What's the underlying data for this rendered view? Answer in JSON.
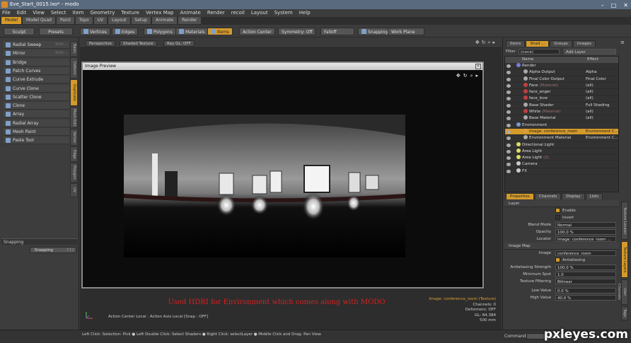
{
  "window": {
    "title": "Eve_Start_0015.lxo* - modo",
    "buttons": [
      "–",
      "□",
      "✕"
    ]
  },
  "menu": [
    "File",
    "Edit",
    "View",
    "Select",
    "Item",
    "Geometry",
    "Texture",
    "Vertex Map",
    "Animate",
    "Render",
    "recoil",
    "Layout",
    "System",
    "Help"
  ],
  "mode_tabs": [
    {
      "label": "Model",
      "active": true
    },
    {
      "label": "Model Quad"
    },
    {
      "label": "Paint"
    },
    {
      "label": "Topo"
    },
    {
      "label": "UV"
    },
    {
      "label": "Layout"
    },
    {
      "label": "Setup"
    },
    {
      "label": "Animate"
    },
    {
      "label": "Render"
    }
  ],
  "toolbar": {
    "sculpt": "Sculpt",
    "presets": "Presets",
    "vertices": "Vertices",
    "edges": "Edges",
    "polygons": "Polygons",
    "materials": "Materials",
    "items": "Items",
    "action_center": "Action Center",
    "symmetry": "Symmetry: Off",
    "falloff": "Falloff",
    "snapping": "Snapping",
    "work_plane": "Work Plane"
  },
  "left_tools": [
    {
      "label": "Radial Sweep",
      "shortcut": "Shift-..."
    },
    {
      "label": "Mirror",
      "shortcut": "Shift-..."
    },
    {
      "label": "Bridge"
    },
    {
      "label": "Patch Curves"
    },
    {
      "label": "Curve Extrude"
    },
    {
      "label": "Curve Clone"
    },
    {
      "label": "Scatter Clone"
    },
    {
      "label": "Clone"
    },
    {
      "label": "Array"
    },
    {
      "label": "Radial Array"
    },
    {
      "label": "Mesh Paint"
    },
    {
      "label": "Paste Tool"
    }
  ],
  "left_vtabs": [
    "Basic",
    "Deform",
    "Duplicate",
    "Mesh Edit",
    "Vertex",
    "Edge",
    "Polygon",
    "UV"
  ],
  "snapping": {
    "header": "Snapping",
    "button": "Snapping",
    "shortcut": "F11"
  },
  "viewport": {
    "perspective": "Perspective",
    "shade": "Shaded Texture",
    "raygl": "Ray GL: OFF",
    "preview_title": "Image Preview",
    "caption": "Used HDRI for Environment which comes along with MODO",
    "info": {
      "image": "Image: conference_room (Texture)",
      "channels": "Channels: 0",
      "deformers": "Deformers: OFF",
      "gl": "GL: 84,384",
      "size": "500 mm"
    },
    "status": "Action Center Local : Action Axis Local  [Snap : OFF]"
  },
  "statusbar": {
    "hint": "Left Click: Selection: Pick ● Left Double Click: Select Shaders ● Right Click: selectLayer ● Middle Click and Drag: Pan View",
    "command": "Command"
  },
  "right_top_tabs": [
    {
      "label": "Items"
    },
    {
      "label": "Shad ...",
      "active": true
    },
    {
      "label": "Groups"
    },
    {
      "label": "Images"
    }
  ],
  "filter": {
    "label": "Filter",
    "value": "(none)",
    "add": "Add Layer"
  },
  "shader_tree": {
    "col_name": "Name",
    "col_effect": "Effect",
    "rows": [
      {
        "name": "Render",
        "effect": "",
        "indent": 0,
        "color": "#7a7ad8"
      },
      {
        "name": "Alpha Output",
        "effect": "Alpha",
        "indent": 1,
        "color": "#aaaaaa"
      },
      {
        "name": "Final Color Output",
        "effect": "Final Color",
        "indent": 1,
        "color": "#aaaaaa"
      },
      {
        "name": "Face",
        "sub": "(Material)",
        "effect": "(all)",
        "indent": 1,
        "color": "#c04040"
      },
      {
        "name": "face_anger",
        "effect": "(all)",
        "indent": 1,
        "color": "#c04040"
      },
      {
        "name": "face_love",
        "effect": "(all)",
        "indent": 1,
        "color": "#c04040"
      },
      {
        "name": "Base Shader",
        "effect": "Full Shading",
        "indent": 1,
        "color": "#aaaaaa"
      },
      {
        "name": "White",
        "sub": "(Material)",
        "effect": "(all)",
        "indent": 1,
        "color": "#c04040"
      },
      {
        "name": "Base Material",
        "effect": "(all)",
        "indent": 1,
        "color": "#aaaaaa"
      },
      {
        "name": "Environment",
        "effect": "",
        "indent": 0,
        "color": "#7a9ad8"
      },
      {
        "name": "Image: conference_room",
        "effect": "Environment C...",
        "indent": 1,
        "color": "#d8a040",
        "selected": true
      },
      {
        "name": "Environment Material",
        "effect": "Environment C...",
        "indent": 1,
        "color": "#aaaaaa"
      },
      {
        "name": "Directional Light",
        "effect": "",
        "indent": 0,
        "color": "#dddd66"
      },
      {
        "name": "Area Light",
        "effect": "",
        "indent": 0,
        "color": "#dddd66"
      },
      {
        "name": "Area Light",
        "sub": "(2)",
        "effect": "",
        "indent": 0,
        "color": "#dddd66"
      },
      {
        "name": "Camera",
        "effect": "",
        "indent": 0,
        "color": "#cccccc"
      },
      {
        "name": "FX",
        "effect": "",
        "indent": 0,
        "color": "#cccccc"
      }
    ]
  },
  "props_tabs": [
    {
      "label": "Properties",
      "active": true
    },
    {
      "label": "Channels"
    },
    {
      "label": "Display"
    },
    {
      "label": "Lists"
    }
  ],
  "right_vtabs": [
    "Texture Locator",
    "Texture Layers",
    "User Channels",
    "Tags"
  ],
  "layer": {
    "header": "Layer",
    "enable": "Enable",
    "invert": "Invert",
    "blend_label": "Blend Mode",
    "blend": "Normal",
    "opacity_label": "Opacity",
    "opacity": "100.0 %",
    "locator_label": "Locator",
    "locator": "Image: conference_room ..."
  },
  "image_map": {
    "header": "Image Map",
    "image_label": "Image",
    "image": "conference_room",
    "antialiasing": "Antialiasing",
    "aa_strength_label": "Antialiasing Strength",
    "aa_strength": "100.0 %",
    "min_spot_label": "Minimum Spot",
    "min_spot": "1.0",
    "filter_label": "Texture Filtering",
    "filter": "Bilinear",
    "low_label": "Low Value",
    "low": "0.0 %",
    "high_label": "High Value",
    "high": "40.0 %"
  },
  "watermark": "pxleyes.com"
}
